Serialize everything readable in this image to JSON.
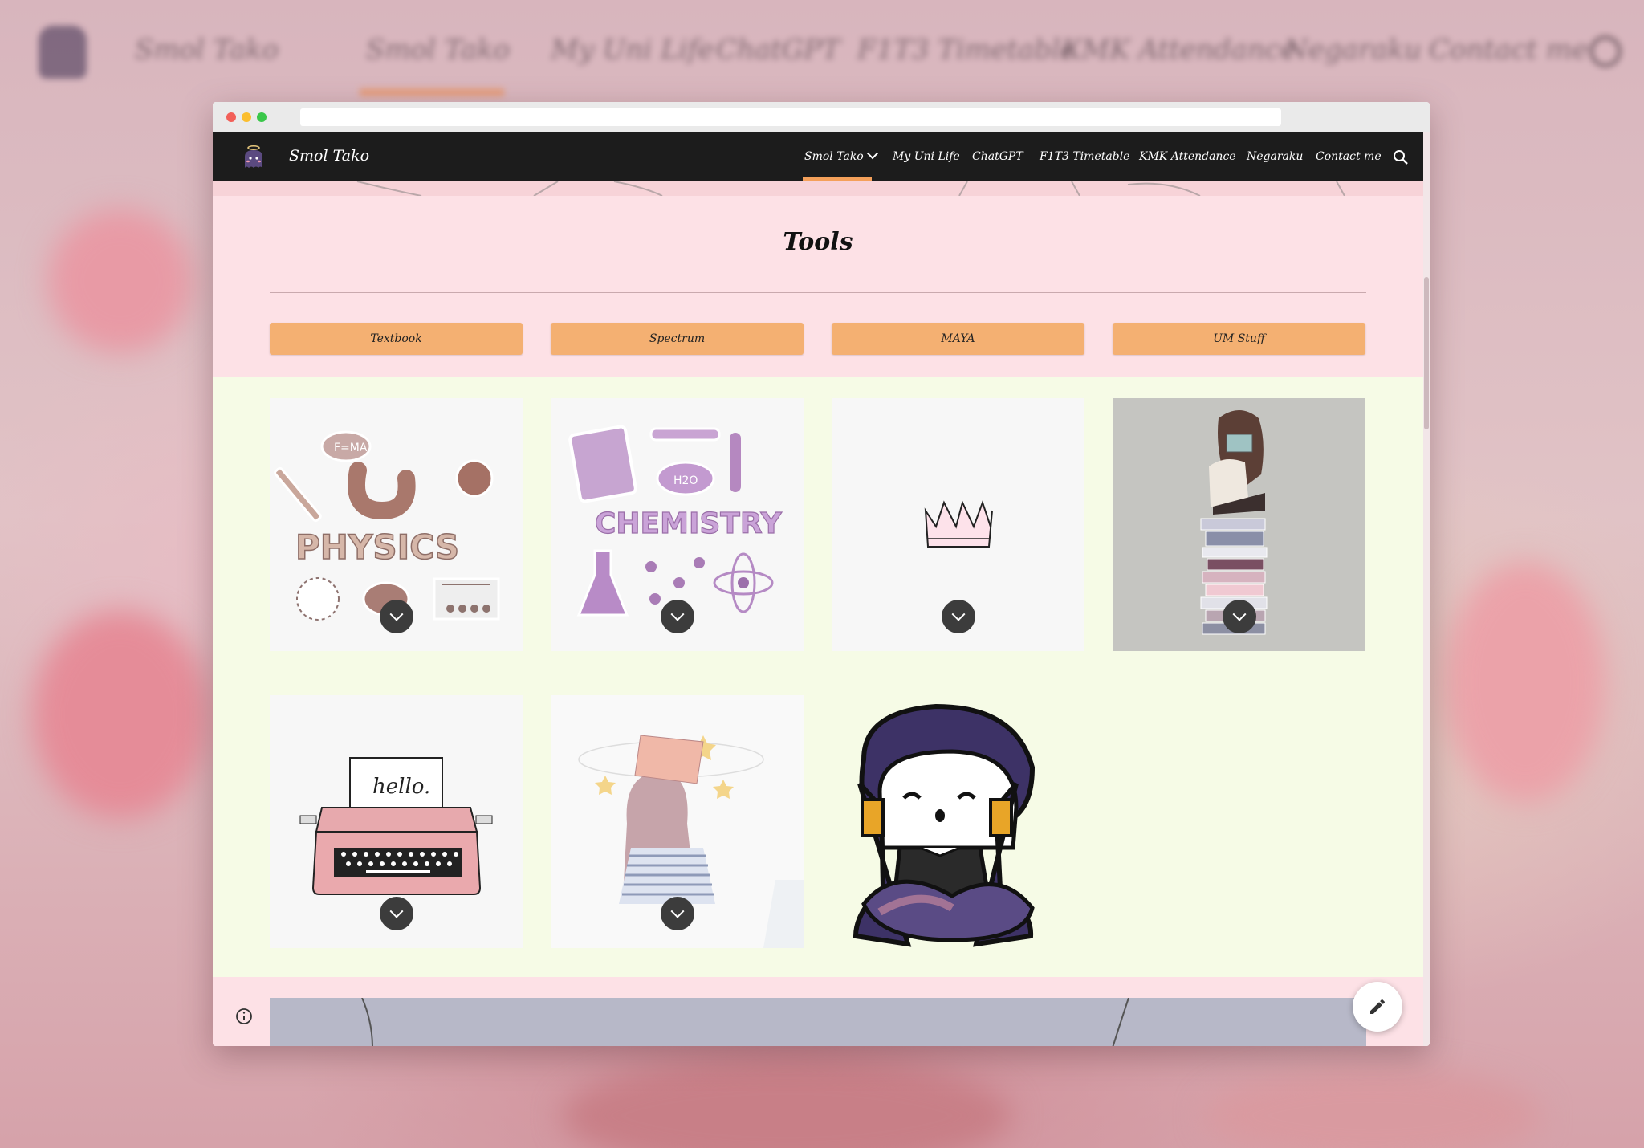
{
  "site": {
    "title": "Smol Tako",
    "nav": [
      {
        "label": "Smol Tako",
        "has_dropdown": true,
        "active": true
      },
      {
        "label": "My Uni Life"
      },
      {
        "label": "ChatGPT"
      },
      {
        "label": "F1T3 Timetable"
      },
      {
        "label": "KMK Attendance"
      },
      {
        "label": "Negaraku"
      },
      {
        "label": "Contact me"
      }
    ]
  },
  "page": {
    "title": "Tools",
    "tabs": [
      "Textbook",
      "Spectrum",
      "MAYA",
      "UM Stuff"
    ]
  },
  "cards": [
    {
      "art": "physics-stickers",
      "text": "PHYSICS",
      "formula": "F=MA"
    },
    {
      "art": "chemistry-stickers",
      "text": "CHEMISTRY",
      "formula": "H2O"
    },
    {
      "art": "pink-crown"
    },
    {
      "art": "girl-on-books"
    },
    {
      "art": "pink-typewriter",
      "text": "hello."
    },
    {
      "art": "girl-book-on-head"
    },
    {
      "art": "chibi-character"
    }
  ],
  "background_nav": [
    "Smol Tako",
    "Smol Tako",
    "My Uni Life",
    "ChatGPT",
    "F1T3 Timetable",
    "KMK Attendance",
    "Negaraku",
    "Contact me"
  ],
  "colors": {
    "accent": "#f4b072",
    "nav_bg": "#1c1c1c",
    "pink_section": "#fde1e6",
    "green_section": "#f6fbe6",
    "active_underline": "#f4a05a"
  },
  "icons": {
    "search": "search-icon",
    "info": "info-icon",
    "edit": "pencil-icon",
    "expand": "chevron-down-icon"
  }
}
